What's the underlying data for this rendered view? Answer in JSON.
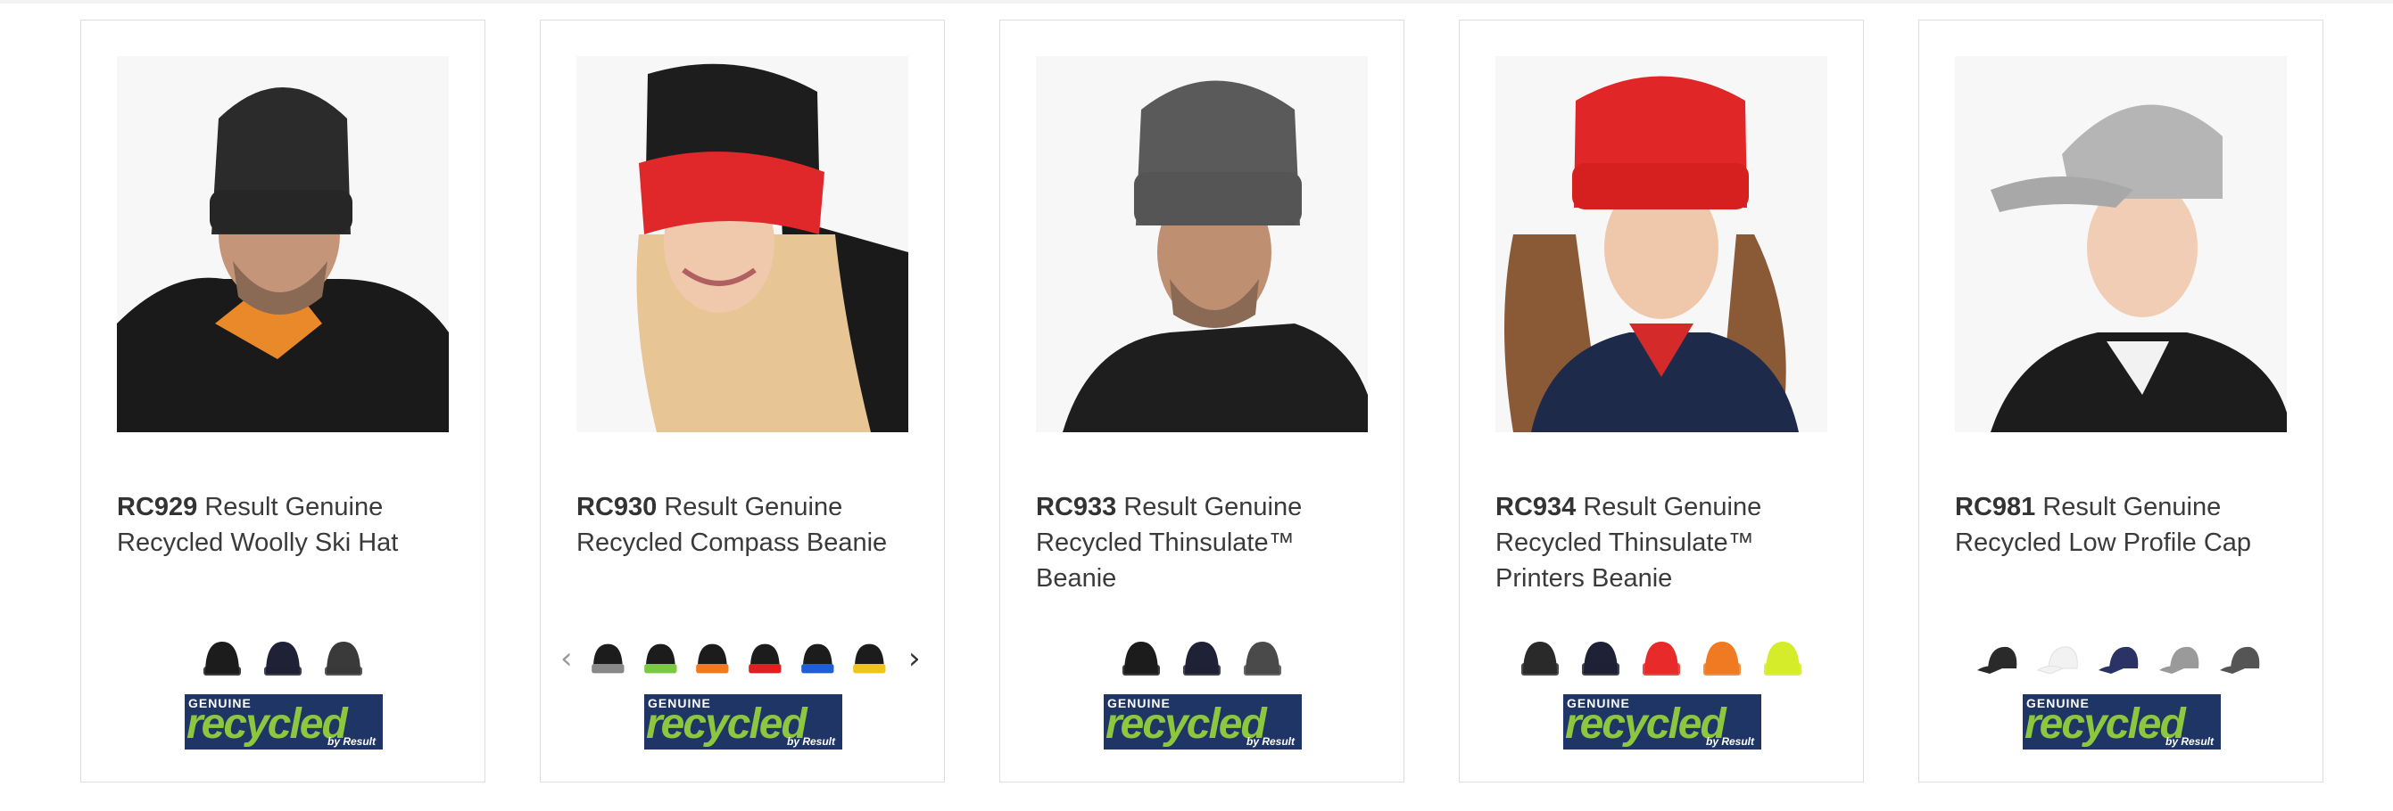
{
  "products": [
    {
      "code": "RC929",
      "name": "Result Genuine Recycled Woolly Ski Hat",
      "swatches": [
        "#1c1c1c",
        "#1f2136",
        "#3a3a3a"
      ],
      "logo": {
        "genuine": "GENUINE",
        "recycled": "recycled",
        "by": "by Result"
      }
    },
    {
      "code": "RC930",
      "name": "Result Genuine Recycled Compass Beanie",
      "swatches": [
        "#1c1c1c",
        "#7ac943",
        "#f07a22",
        "#e02020",
        "#1f5fd6",
        "#f0c419"
      ],
      "logo": {
        "genuine": "GENUINE",
        "recycled": "recycled",
        "by": "by Result"
      }
    },
    {
      "code": "RC933",
      "name": "Result Genuine Recycled Thinsulate™ Beanie",
      "swatches": [
        "#1c1c1c",
        "#1f2136",
        "#4a4a4a"
      ],
      "logo": {
        "genuine": "GENUINE",
        "recycled": "recycled",
        "by": "by Result"
      }
    },
    {
      "code": "RC934",
      "name": "Result Genuine Recycled Thinsulate™ Printers Beanie",
      "swatches": [
        "#2a2a2a",
        "#1f2136",
        "#e82a2a",
        "#f07a22",
        "#d4ec2a"
      ],
      "logo": {
        "genuine": "GENUINE",
        "recycled": "recycled",
        "by": "by Result"
      }
    },
    {
      "code": "RC981",
      "name": "Result Genuine Recycled Low Profile Cap",
      "swatches": [
        "#2a2a2a",
        "#f2f2f2",
        "#2a3266",
        "#9a9a9a",
        "#555555"
      ],
      "logo": {
        "genuine": "GENUINE",
        "recycled": "recycled",
        "by": "by Result"
      }
    }
  ],
  "carousel": {
    "prev_icon": "chevron-left-icon",
    "next_icon": "chevron-right-icon"
  }
}
